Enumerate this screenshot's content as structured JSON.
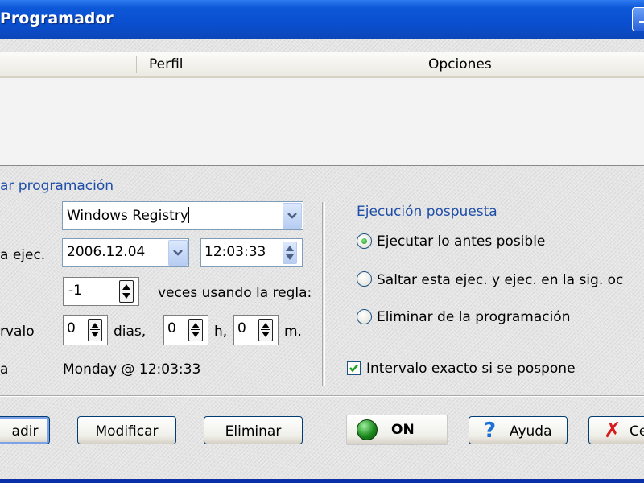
{
  "window": {
    "title": "Programador"
  },
  "list": {
    "columns": [
      "",
      "Perfil",
      "Opciones"
    ]
  },
  "schedule": {
    "group_title": "ar programación",
    "labels": {
      "profile": "",
      "next_run": "a ejec.",
      "repeat": "",
      "interval": "rvalo",
      "next": "a"
    },
    "profile_value": "Windows Registry",
    "date_value": "2006.12.04",
    "time_value": "12:03:33",
    "repeat_value": "-1",
    "repeat_suffix": "veces usando la regla:",
    "interval": {
      "days": "0",
      "days_unit": "dias,",
      "hours": "0",
      "hours_unit": "h,",
      "minutes": "0",
      "minutes_unit": "m."
    },
    "next_run_text": "Monday @ 12:03:33"
  },
  "postponed": {
    "title": "Ejecución pospuesta",
    "options": [
      {
        "label": "Ejecutar lo antes posible",
        "selected": true
      },
      {
        "label": "Saltar esta ejec. y ejec. en la sig. oc",
        "selected": false
      },
      {
        "label": "Eliminar de la programación",
        "selected": false
      }
    ],
    "exact_interval_label": "Intervalo exacto si se pospone",
    "exact_interval_checked": true
  },
  "buttons": {
    "add": "adir",
    "modify": "Modificar",
    "delete": "Eliminar",
    "on": "ON",
    "help": "Ayuda",
    "help_icon": "?",
    "close": "Ce",
    "close_icon": "✗"
  }
}
